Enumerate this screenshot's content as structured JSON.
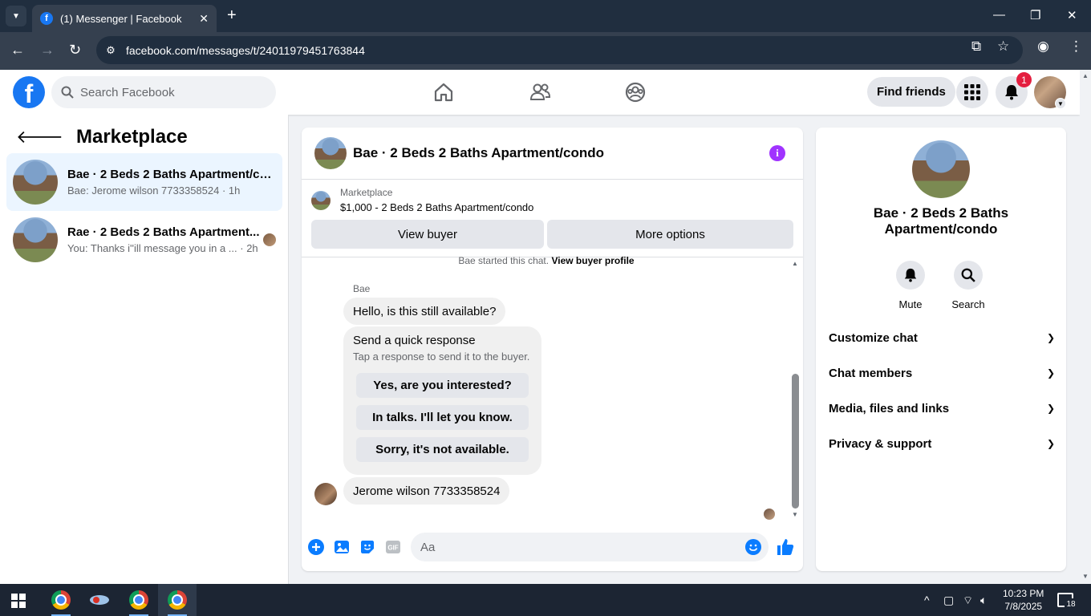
{
  "browser": {
    "tab_title": "(1) Messenger | Facebook",
    "tab_favicon": "f",
    "url": "facebook.com/messages/t/24011979451763844"
  },
  "fb_header": {
    "search_placeholder": "Search Facebook",
    "find_friends_label": "Find friends",
    "notification_count": "1",
    "logo_letter": "f"
  },
  "sidebar": {
    "title": "Marketplace",
    "conversations": [
      {
        "name": "Bae · 2 Beds 2 Baths Apartment/co...",
        "preview": "Bae: Jerome wilson 7733358524 · 1h",
        "active": true
      },
      {
        "name": "Rae · 2 Beds 2 Baths Apartment...",
        "preview": "You: Thanks i''ill message you in a ... · 2h",
        "active": false
      }
    ]
  },
  "chat": {
    "title": "Bae · 2 Beds 2 Baths Apartment/condo",
    "info_glyph": "i",
    "listing_category": "Marketplace",
    "listing_price_title": "$1,000 - 2 Beds 2 Baths Apartment/condo",
    "view_buyer_label": "View buyer",
    "more_options_label": "More options",
    "started_text": "Bae started this chat.",
    "view_buyer_profile_label": "View buyer profile",
    "sender_name": "Bae",
    "messages": [
      "Hello, is this still available?",
      "Jerome wilson 7733358524"
    ],
    "quick_response": {
      "title": "Send a quick response",
      "subtitle": "Tap a response to send it to the buyer.",
      "options": [
        "Yes, are you interested?",
        "In talks. I'll let you know.",
        "Sorry, it's not available."
      ]
    },
    "composer_placeholder": "Aa",
    "gif_label": "GIF"
  },
  "info_panel": {
    "title": "Bae · 2 Beds 2 Baths Apartment/condo",
    "actions": [
      {
        "label": "Mute",
        "icon": "bell-icon"
      },
      {
        "label": "Search",
        "icon": "search-icon"
      }
    ],
    "sections": [
      "Customize chat",
      "Chat members",
      "Media, files and links",
      "Privacy & support"
    ]
  },
  "taskbar": {
    "time": "10:23 PM",
    "date": "7/8/2025",
    "notification_count": "18"
  },
  "colors": {
    "facebook_blue": "#1877f2",
    "messenger_accent": "#0a7cff",
    "info_purple": "#a033ff",
    "badge_red": "#e41e3f"
  }
}
